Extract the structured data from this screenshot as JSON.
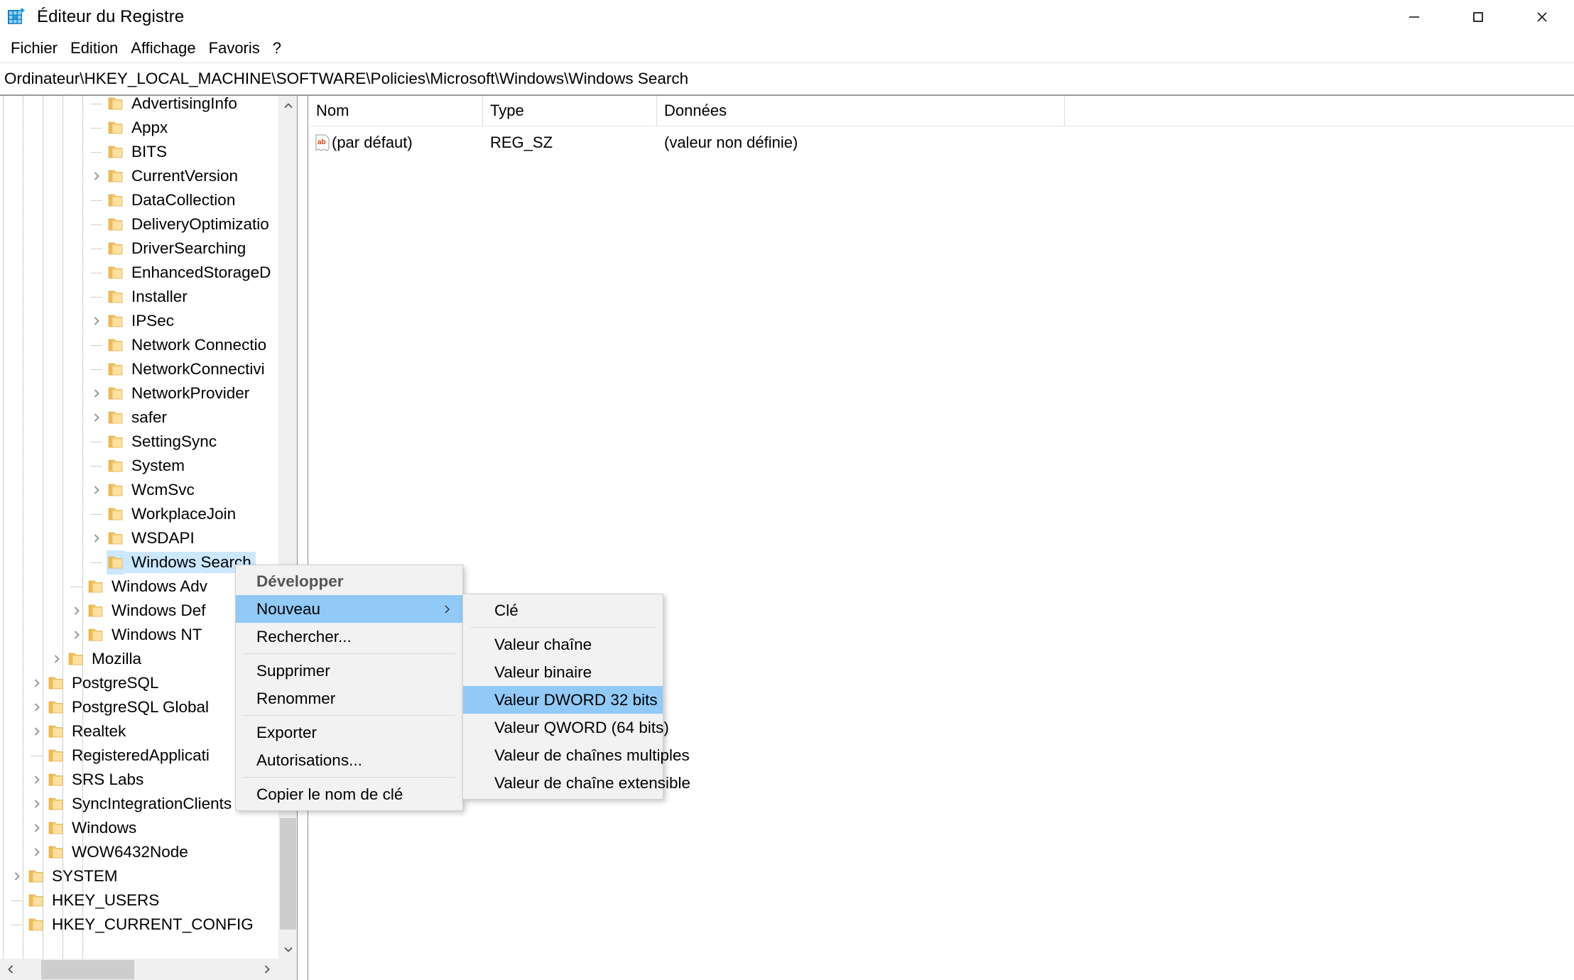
{
  "window": {
    "title": "Éditeur du Registre",
    "icon": "registry-editor-icon",
    "controls": {
      "minimize": "minimize-icon",
      "maximize": "maximize-icon",
      "close": "close-icon"
    }
  },
  "menubar": {
    "items": [
      {
        "label": "Fichier"
      },
      {
        "label": "Edition"
      },
      {
        "label": "Affichage"
      },
      {
        "label": "Favoris"
      },
      {
        "label": "?"
      }
    ]
  },
  "address": {
    "path": "Ordinateur\\HKEY_LOCAL_MACHINE\\SOFTWARE\\Policies\\Microsoft\\Windows\\Windows Search"
  },
  "tree": {
    "items": [
      {
        "label": "AdvertisingInfo",
        "depth": 4,
        "expander": "none",
        "selected": false
      },
      {
        "label": "Appx",
        "depth": 4,
        "expander": "none",
        "selected": false
      },
      {
        "label": "BITS",
        "depth": 4,
        "expander": "none",
        "selected": false
      },
      {
        "label": "CurrentVersion",
        "depth": 4,
        "expander": "collapsed",
        "selected": false
      },
      {
        "label": "DataCollection",
        "depth": 4,
        "expander": "none",
        "selected": false
      },
      {
        "label": "DeliveryOptimizatio",
        "depth": 4,
        "expander": "none",
        "selected": false
      },
      {
        "label": "DriverSearching",
        "depth": 4,
        "expander": "none",
        "selected": false
      },
      {
        "label": "EnhancedStorageD",
        "depth": 4,
        "expander": "none",
        "selected": false
      },
      {
        "label": "Installer",
        "depth": 4,
        "expander": "none",
        "selected": false
      },
      {
        "label": "IPSec",
        "depth": 4,
        "expander": "collapsed",
        "selected": false
      },
      {
        "label": "Network Connectio",
        "depth": 4,
        "expander": "none",
        "selected": false
      },
      {
        "label": "NetworkConnectivi",
        "depth": 4,
        "expander": "none",
        "selected": false
      },
      {
        "label": "NetworkProvider",
        "depth": 4,
        "expander": "collapsed",
        "selected": false
      },
      {
        "label": "safer",
        "depth": 4,
        "expander": "collapsed",
        "selected": false
      },
      {
        "label": "SettingSync",
        "depth": 4,
        "expander": "none",
        "selected": false
      },
      {
        "label": "System",
        "depth": 4,
        "expander": "none",
        "selected": false
      },
      {
        "label": "WcmSvc",
        "depth": 4,
        "expander": "collapsed",
        "selected": false
      },
      {
        "label": "WorkplaceJoin",
        "depth": 4,
        "expander": "none",
        "selected": false
      },
      {
        "label": "WSDAPI",
        "depth": 4,
        "expander": "collapsed",
        "selected": false
      },
      {
        "label": "Windows Search",
        "depth": 4,
        "expander": "none",
        "selected": true
      },
      {
        "label": "Windows Adv",
        "depth": 3,
        "expander": "none",
        "selected": false
      },
      {
        "label": "Windows Def",
        "depth": 3,
        "expander": "collapsed",
        "selected": false
      },
      {
        "label": "Windows NT",
        "depth": 3,
        "expander": "collapsed",
        "selected": false
      },
      {
        "label": "Mozilla",
        "depth": 2,
        "expander": "collapsed",
        "selected": false
      },
      {
        "label": "PostgreSQL",
        "depth": 1,
        "expander": "collapsed",
        "selected": false
      },
      {
        "label": "PostgreSQL Global",
        "depth": 1,
        "expander": "collapsed",
        "selected": false
      },
      {
        "label": "Realtek",
        "depth": 1,
        "expander": "collapsed",
        "selected": false
      },
      {
        "label": "RegisteredApplicati",
        "depth": 1,
        "expander": "none",
        "selected": false
      },
      {
        "label": "SRS Labs",
        "depth": 1,
        "expander": "collapsed",
        "selected": false
      },
      {
        "label": "SyncIntegrationClients",
        "depth": 1,
        "expander": "collapsed",
        "selected": false
      },
      {
        "label": "Windows",
        "depth": 1,
        "expander": "collapsed",
        "selected": false
      },
      {
        "label": "WOW6432Node",
        "depth": 1,
        "expander": "collapsed",
        "selected": false
      },
      {
        "label": "SYSTEM",
        "depth": 0,
        "expander": "collapsed",
        "selected": false
      },
      {
        "label": "HKEY_USERS",
        "depth": 0,
        "expander": "none",
        "selected": false
      },
      {
        "label": "HKEY_CURRENT_CONFIG",
        "depth": 0,
        "expander": "none",
        "selected": false
      }
    ]
  },
  "list": {
    "columns": [
      {
        "label": "Nom"
      },
      {
        "label": "Type"
      },
      {
        "label": "Données"
      }
    ],
    "rows": [
      {
        "icon": "string-value-icon",
        "name": "(par défaut)",
        "type": "REG_SZ",
        "data": "(valeur non définie)"
      }
    ]
  },
  "context_menu": {
    "items": [
      {
        "label": "Développer",
        "bold": true,
        "highlight": false,
        "submenu": false,
        "separator_after": false
      },
      {
        "label": "Nouveau",
        "bold": false,
        "highlight": true,
        "submenu": true,
        "separator_after": false
      },
      {
        "label": "Rechercher...",
        "bold": false,
        "highlight": false,
        "submenu": false,
        "separator_after": true
      },
      {
        "label": "Supprimer",
        "bold": false,
        "highlight": false,
        "submenu": false,
        "separator_after": false
      },
      {
        "label": "Renommer",
        "bold": false,
        "highlight": false,
        "submenu": false,
        "separator_after": true
      },
      {
        "label": "Exporter",
        "bold": false,
        "highlight": false,
        "submenu": false,
        "separator_after": false
      },
      {
        "label": "Autorisations...",
        "bold": false,
        "highlight": false,
        "submenu": false,
        "separator_after": true
      },
      {
        "label": "Copier le nom de clé",
        "bold": false,
        "highlight": false,
        "submenu": false,
        "separator_after": false
      }
    ]
  },
  "submenu": {
    "items": [
      {
        "label": "Clé",
        "highlight": false,
        "separator_after": true
      },
      {
        "label": "Valeur chaîne",
        "highlight": false,
        "separator_after": false
      },
      {
        "label": "Valeur binaire",
        "highlight": false,
        "separator_after": false
      },
      {
        "label": "Valeur DWORD 32 bits",
        "highlight": true,
        "separator_after": false
      },
      {
        "label": "Valeur QWORD (64 bits)",
        "highlight": false,
        "separator_after": false
      },
      {
        "label": "Valeur de chaînes multiples",
        "highlight": false,
        "separator_after": false
      },
      {
        "label": "Valeur de chaîne extensible",
        "highlight": false,
        "separator_after": false
      }
    ]
  },
  "colors": {
    "selection": "#cce8ff",
    "menu_highlight": "#91c9f7",
    "folder": "#ffd271",
    "scrollbar_thumb": "#cdcdcd"
  },
  "scrollbars": {
    "tree_vertical": {
      "up_icon": "chevron-up-icon",
      "down_icon": "chevron-down-icon"
    },
    "tree_horizontal": {
      "left_icon": "chevron-left-icon",
      "right_icon": "chevron-right-icon"
    }
  }
}
